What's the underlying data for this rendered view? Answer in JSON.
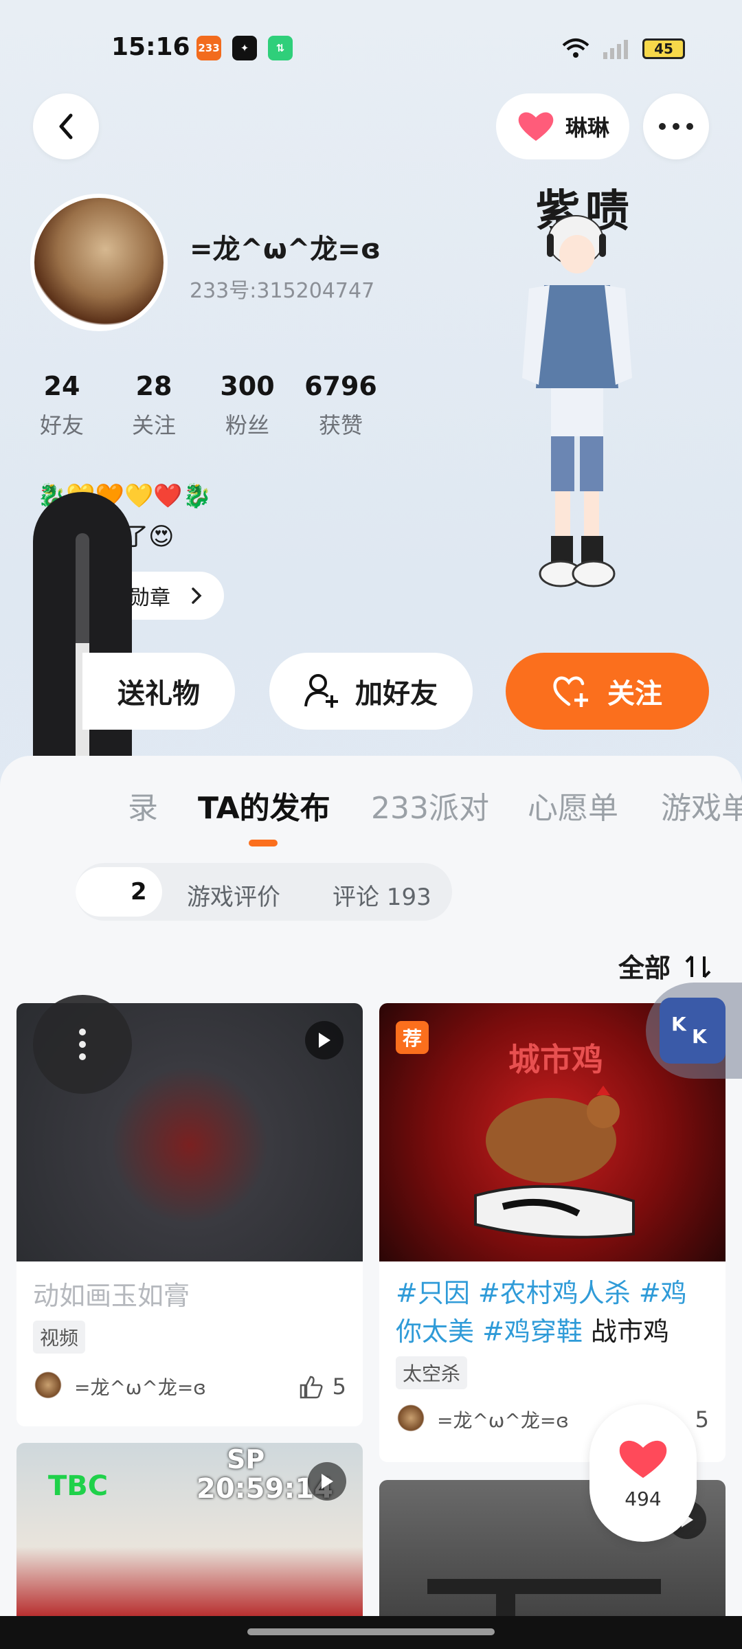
{
  "status": {
    "time": "15:16",
    "app_icons": [
      "233",
      "✦",
      "⇅"
    ],
    "battery": "45"
  },
  "header": {
    "partner_name": "琳琳"
  },
  "profile": {
    "nickname": "=龙^ω^龙=ɞ",
    "uid": "233号:315204747",
    "stats": [
      {
        "num": "24",
        "label": "好友"
      },
      {
        "num": "28",
        "label": "关注"
      },
      {
        "num": "300",
        "label": "粉丝"
      },
      {
        "num": "6796",
        "label": "获赞"
      }
    ],
    "bio_line1": "🐉💛🧡💛❤️🐉",
    "bio_line2": "了😍",
    "badge_label": "勋章"
  },
  "character": {
    "name": "紫啧"
  },
  "actions": {
    "gift": "送礼物",
    "add_friend": "加好友",
    "follow": "关注"
  },
  "tabs": [
    "录",
    "TA的发布",
    "233派对",
    "心愿单",
    "游戏单"
  ],
  "subtabs": [
    "2",
    "游戏评价",
    "评论 193"
  ],
  "sort": {
    "label": "全部"
  },
  "cards": [
    {
      "title": "动如画玉如膏",
      "tag": "视频",
      "author": "=龙^ω^龙=ɞ",
      "likes": "5"
    },
    {
      "badge": "荐",
      "thumb_caption": "城市鸡",
      "hashtags": "#只因 #农村鸡人杀 #鸡你太美 #鸡穿鞋",
      "title_rest": "战市鸡",
      "tag": "太空杀",
      "author": "=龙^ω^龙=ɞ",
      "likes": "5"
    },
    {
      "thumb_text_left": "TBC",
      "thumb_text_right1": "SP",
      "thumb_text_right2": "20:59:14"
    },
    {}
  ],
  "float_like": {
    "count": "494"
  },
  "colors": {
    "accent": "#fb6f1d",
    "hashtag": "#2f9bd8"
  }
}
